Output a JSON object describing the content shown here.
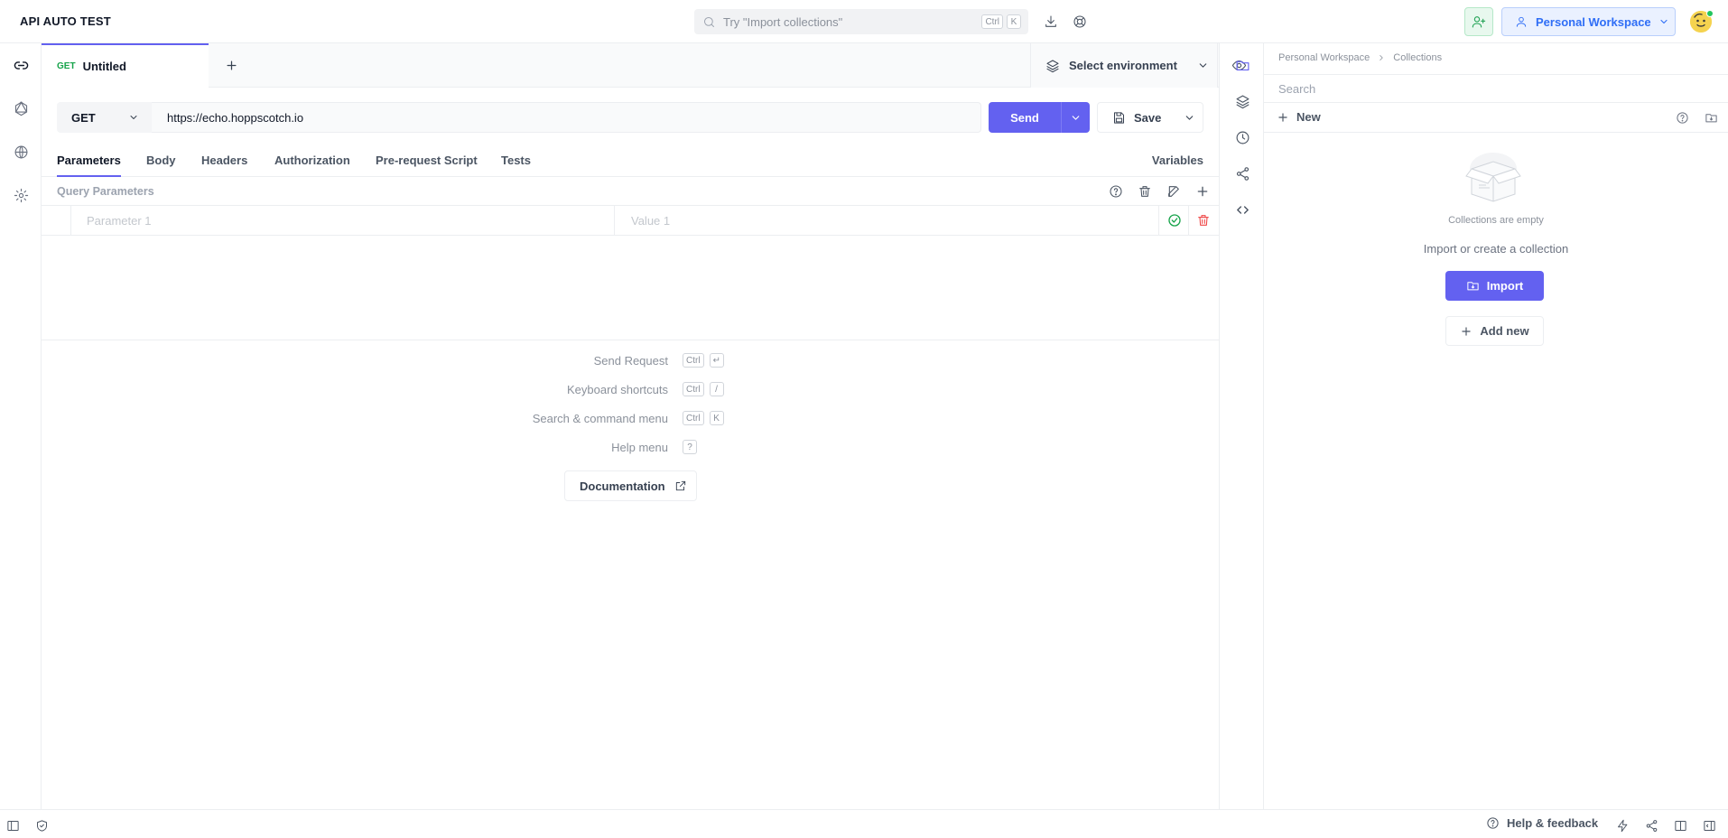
{
  "header": {
    "app_title": "API AUTO TEST",
    "search_placeholder": "Try \"Import collections\"",
    "search_keys": [
      "Ctrl",
      "K"
    ],
    "workspace_label": "Personal Workspace"
  },
  "tabs": [
    {
      "method": "GET",
      "label": "Untitled"
    }
  ],
  "environment": {
    "label": "Select environment"
  },
  "request": {
    "method": "GET",
    "url": "https://echo.hoppscotch.io",
    "send_label": "Send",
    "save_label": "Save"
  },
  "request_tabs": [
    "Parameters",
    "Body",
    "Headers",
    "Authorization",
    "Pre-request Script",
    "Tests"
  ],
  "variables_label": "Variables",
  "query_params": {
    "title": "Query Parameters",
    "key_placeholder": "Parameter 1",
    "value_placeholder": "Value 1"
  },
  "shortcuts": [
    {
      "label": "Send Request",
      "keys": [
        "Ctrl",
        "↵"
      ]
    },
    {
      "label": "Keyboard shortcuts",
      "keys": [
        "Ctrl",
        "/"
      ]
    },
    {
      "label": "Search & command menu",
      "keys": [
        "Ctrl",
        "K"
      ]
    },
    {
      "label": "Help menu",
      "keys": [
        "?"
      ]
    }
  ],
  "documentation_label": "Documentation",
  "collections": {
    "breadcrumb": [
      "Personal Workspace",
      "Collections"
    ],
    "search_placeholder": "Search",
    "new_label": "New",
    "empty_title": "Collections are empty",
    "empty_subtitle": "Import or create a collection",
    "import_label": "Import",
    "add_new_label": "Add new"
  },
  "footer": {
    "help_label": "Help & feedback"
  },
  "colors": {
    "accent": "#6361f0",
    "method_get": "#16a34a",
    "workspace": "#2f6ef6",
    "danger": "#ef4444"
  }
}
